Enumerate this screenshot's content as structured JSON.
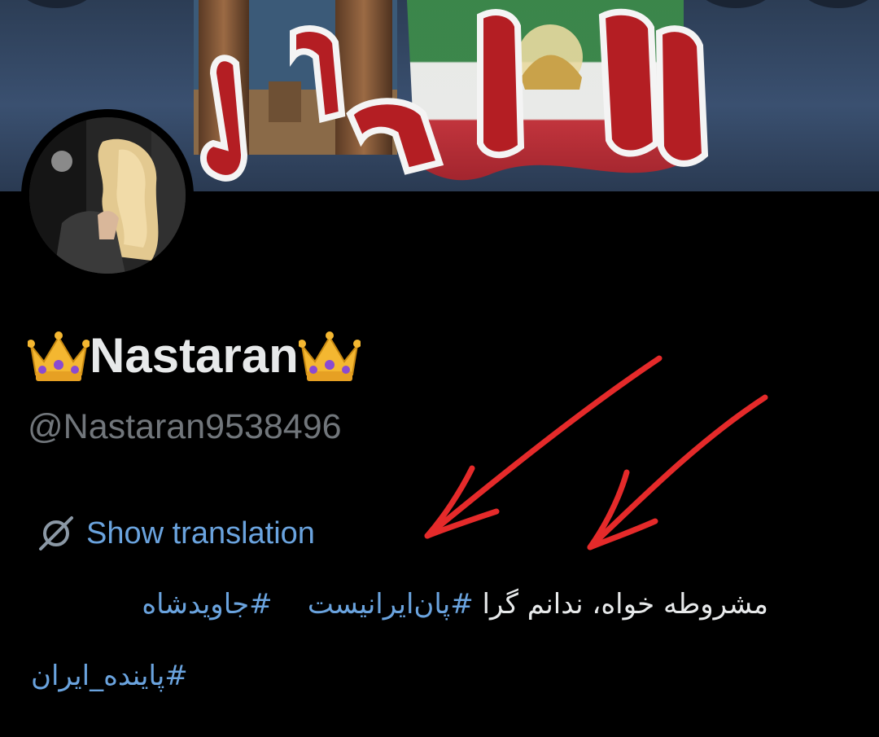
{
  "profile": {
    "display_name": "Nastaran",
    "name_prefix_emoji": "crown-emoji",
    "name_suffix_emoji": "crown-emoji",
    "handle": "@Nastaran9538496"
  },
  "translation": {
    "label": "Show translation",
    "icon": "translate-icon"
  },
  "bio": {
    "text": "مشروطه خواه، ندانم گرا",
    "hashtags": [
      "#پان‌ایرانیست",
      "#جاویدشاه",
      "#پاینده_ایران"
    ]
  },
  "banner": {
    "text": "ایران",
    "description": "Iranian lion and sun flag banner"
  },
  "colors": {
    "background": "#000000",
    "text_primary": "#e7e9ea",
    "text_secondary": "#71767b",
    "link": "#6aa3de",
    "annotation_arrow": "#e52a2a",
    "banner_text": "#b41e23"
  }
}
